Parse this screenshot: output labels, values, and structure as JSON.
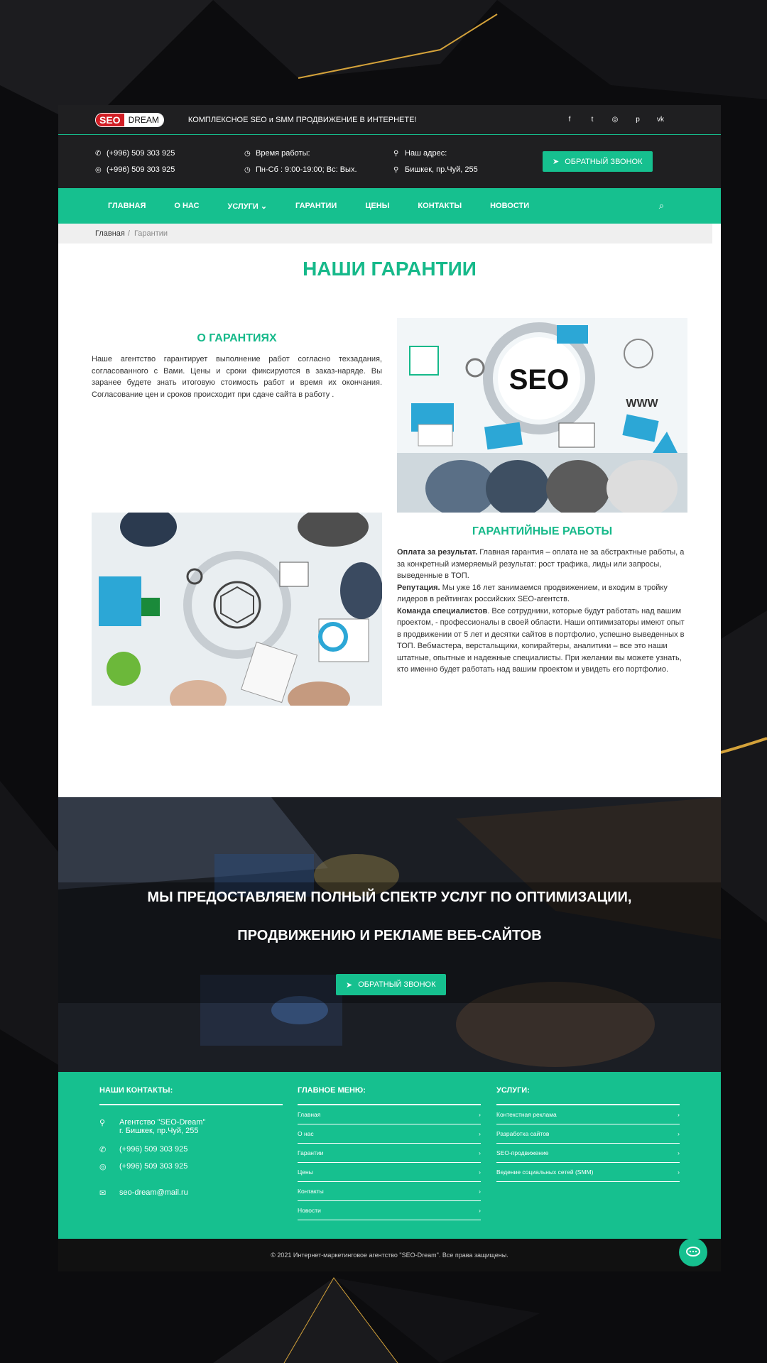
{
  "header": {
    "logo_seo": "SEO",
    "logo_dream": "DREAM",
    "tagline": "КОМПЛЕКСНОЕ SEO и SMM ПРОДВИЖЕНИЕ В ИНТЕРНЕТЕ!",
    "socials": [
      "f",
      "t",
      "◎",
      "p",
      "vk"
    ]
  },
  "contacts_bar": {
    "phone1": "(+996) 509 303 925",
    "phone2": "(+996) 509 303 925",
    "hours_label": "Время работы:",
    "hours_value": "Пн-Сб : 9:00-19:00; Вс: Вых.",
    "address_label": "Наш адрес:",
    "address_value": "Бишкек, пр.Чуй, 255",
    "callback_button": "ОБРАТНЫЙ ЗВОНОК"
  },
  "nav": {
    "items": [
      "ГЛАВНАЯ",
      "О НАС",
      "УСЛУГИ",
      "ГАРАНТИИ",
      "ЦЕНЫ",
      "КОНТАКТЫ",
      "НОВОСТИ"
    ]
  },
  "breadcrumb": {
    "home": "Главная",
    "separator": "/",
    "current": "Гарантии"
  },
  "page": {
    "title": "НАШИ ГАРАНТИИ",
    "section1_title": "О ГАРАНТИЯХ",
    "section1_text": "Наше агентство гарантирует выполнение работ согласно техзадания, согласованного с Вами. Цены и сроки фиксируются в заказ-наряде. Вы заранее будете знать итоговую стоимость работ и время их окончания. Согласование цен и сроков происходит при сдаче сайта в работу .",
    "seo_image_label": "SEO",
    "www_label": "WWW",
    "section2_title": "ГАРАНТИЙНЫЕ РАБОТЫ",
    "p1_bold": "Оплата за результат.",
    "p1_text": " Главная гарантия – оплата не за абстрактные работы, а за конкретный измеряемый результат: рост трафика, лиды или запросы, выведенные в ТОП.",
    "p2_bold": "Репутация.",
    "p2_text": " Мы уже 16 лет занимаемся продвижением, и входим в тройку лидеров в рейтингах российских SEO-агентств.",
    "p3_bold": "Команда специалистов",
    "p3_text": ". Все сотрудники, которые будут работать над вашим проектом, - профессионалы в своей области. Наши оптимизаторы имеют опыт в продвижении от 5 лет и десятки сайтов в портфолио, успешно выведенных в ТОП. Вебмастера, верстальщики, копирайтеры, аналитики – все это наши штатные, опытные и надежные специалисты. При желании вы можете узнать, кто именно будет работать над вашим проектом и увидеть его портфолио."
  },
  "cta": {
    "line1": "МЫ ПРЕДОСТАВЛЯЕМ ПОЛНЫЙ СПЕКТР УСЛУГ ПО ОПТИМИЗАЦИИ,",
    "line2": "ПРОДВИЖЕНИЮ И РЕКЛАМЕ ВЕБ-САЙТОВ",
    "button": "ОБРАТНЫЙ ЗВОНОК"
  },
  "footer": {
    "contacts_title": "НАШИ КОНТАКТЫ:",
    "agency_name": "Агентство \"SEO-Dream\"",
    "agency_address": "г. Бишкек, пр.Чуй, 255",
    "phone1": "(+996) 509 303 925",
    "phone2": "(+996) 509 303 925",
    "email": "seo-dream@mail.ru",
    "menu_title": "ГЛАВНОЕ МЕНЮ:",
    "menu_items": [
      "Главная",
      "О нас",
      "Гарантии",
      "Цены",
      "Контакты",
      "Новости"
    ],
    "services_title": "УСЛУГИ:",
    "services_items": [
      "Контекстная реклама",
      "Разработка сайтов",
      "SEO-продвижение",
      "Ведение социальных сетей (SMM)"
    ],
    "copyright": "© 2021 Интернет-маркетинговое агентство \"SEO-Dream\". Все права защищены."
  },
  "colors": {
    "accent": "#16c08f",
    "dark": "#1f1f21",
    "background": "#0c0c0e",
    "gold": "#d4a23a"
  }
}
